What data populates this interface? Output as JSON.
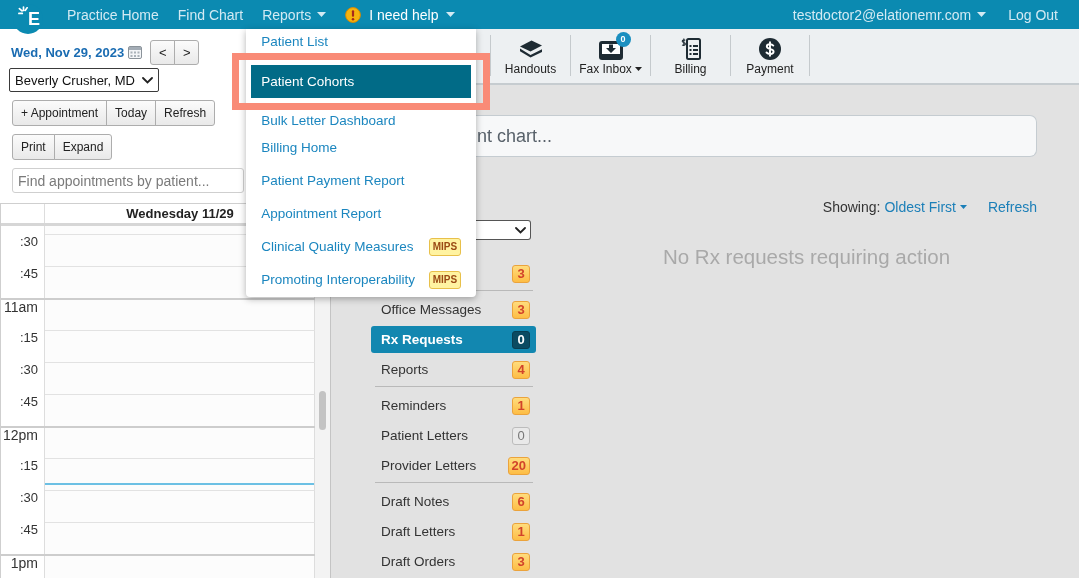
{
  "logo": {
    "letter": "E"
  },
  "nav": {
    "items": [
      {
        "kind": "link",
        "label": "Practice Home"
      },
      {
        "kind": "link",
        "label": "Find Chart"
      },
      {
        "kind": "menu",
        "label": "Reports",
        "expanded": true,
        "menu": {
          "items": [
            {
              "label": "Patient List",
              "selected": false,
              "annotated": false
            },
            {
              "label": "Patient Cohorts",
              "selected": true,
              "annotated": true
            },
            {
              "label": "Bulk Letter Dashboard",
              "selected": false,
              "annotated": false
            },
            {
              "label": "Billing Home",
              "selected": false,
              "annotated": false
            },
            {
              "label": "Patient Payment Report",
              "selected": false,
              "annotated": false
            },
            {
              "label": "Appointment Report",
              "selected": false,
              "annotated": false
            },
            {
              "label": "Clinical Quality Measures",
              "selected": false,
              "annotated": false,
              "tag": "MIPS"
            },
            {
              "label": "Promoting Interoperability",
              "selected": false,
              "annotated": false,
              "tag": "MIPS"
            }
          ]
        }
      },
      {
        "kind": "help",
        "label": "I need help",
        "expanded": false
      }
    ],
    "account": "testdoctor2@elationemr.com",
    "logout": "Log Out"
  },
  "schedule": {
    "date": "Wed, Nov 29, 2023",
    "prev": "<",
    "next": ">",
    "provider": "Beverly Crusher, MD",
    "button_groups": [
      {
        "buttons": [
          "+ Appointment",
          "Today",
          "Refresh"
        ]
      },
      {
        "buttons": [
          "Print",
          "Expand"
        ]
      }
    ],
    "search": {
      "placeholder": "Find appointments by patient..."
    },
    "day_header": "Wednesday 11/29",
    "slots": [
      {
        "kind": "quarter",
        "label": ":30",
        "now_line": false
      },
      {
        "kind": "quarter",
        "label": ":45",
        "now_line": false
      },
      {
        "kind": "hour",
        "label": "11am",
        "now_line": false
      },
      {
        "kind": "quarter",
        "label": ":15",
        "now_line": false
      },
      {
        "kind": "quarter",
        "label": ":30",
        "now_line": false
      },
      {
        "kind": "quarter",
        "label": ":45",
        "now_line": false
      },
      {
        "kind": "hour",
        "label": "12pm",
        "now_line": false
      },
      {
        "kind": "quarter",
        "label": ":15",
        "now_line": true
      },
      {
        "kind": "quarter",
        "label": ":30",
        "now_line": false
      },
      {
        "kind": "quarter",
        "label": ":45",
        "now_line": false
      },
      {
        "kind": "hour",
        "label": "1pm",
        "now_line": false
      }
    ]
  },
  "toolbar": {
    "items": [
      {
        "kind": "handouts",
        "label": "Handouts",
        "has_menu": false
      },
      {
        "kind": "fax",
        "label": "Fax Inbox",
        "count": "0",
        "has_menu": true
      },
      {
        "kind": "billing",
        "label": "Billing",
        "has_menu": false
      },
      {
        "kind": "payment",
        "label": "Payment",
        "has_menu": false
      }
    ]
  },
  "chart_search": {
    "placeholder": "nt chart..."
  },
  "inbox": {
    "groups": [
      {
        "items": [
          {
            "count": "3",
            "alert": true,
            "selected": false
          }
        ]
      },
      {
        "items": [
          {
            "label": "Office Messages",
            "count": "3",
            "alert": true,
            "selected": false
          },
          {
            "label": "Rx Requests",
            "count": "0",
            "alert": false,
            "selected": true
          },
          {
            "label": "Reports",
            "count": "4",
            "alert": true,
            "selected": false
          }
        ]
      },
      {
        "items": [
          {
            "label": "Reminders",
            "count": "1",
            "alert": true,
            "selected": false
          },
          {
            "label": "Patient Letters",
            "count": "0",
            "alert": false,
            "selected": false
          },
          {
            "label": "Provider Letters",
            "count": "20",
            "alert": true,
            "selected": false
          }
        ]
      },
      {
        "items": [
          {
            "label": "Draft Notes",
            "count": "6",
            "alert": true,
            "selected": false
          },
          {
            "label": "Draft Letters",
            "count": "1",
            "alert": true,
            "selected": false
          },
          {
            "label": "Draft Orders",
            "count": "3",
            "alert": true,
            "selected": false
          }
        ]
      }
    ]
  },
  "requests": {
    "sort_label": "Showing:",
    "sort_value": "Oldest First",
    "refresh": "Refresh",
    "empty_message": "No Rx requests requiring action"
  }
}
